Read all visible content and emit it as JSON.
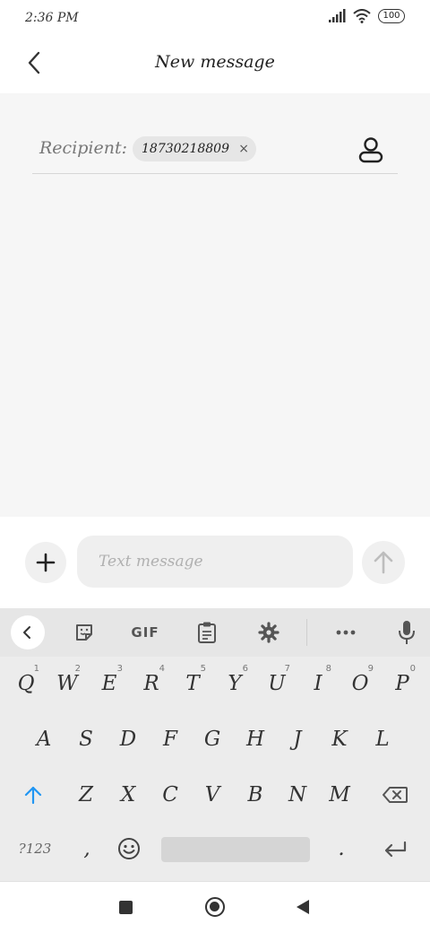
{
  "status_bar": {
    "time": "2:36 PM",
    "battery": "100"
  },
  "header": {
    "title": "New message",
    "back_icon": "chevron-left-icon"
  },
  "recipient": {
    "label": "Recipient:",
    "chip_value": "18730218809",
    "chip_remove": "×",
    "contact_icon": "person-icon"
  },
  "compose": {
    "placeholder": "Text message",
    "add_icon": "plus-icon",
    "send_icon": "arrow-up-icon"
  },
  "keyboard": {
    "toolbar": {
      "collapse_icon": "chevron-left-icon",
      "sticker_icon": "sticker-icon",
      "gif_label": "GIF",
      "clipboard_icon": "clipboard-icon",
      "settings_icon": "gear-icon",
      "more_icon": "more-horizontal-icon",
      "mic_icon": "microphone-icon"
    },
    "row1": [
      {
        "key": "Q",
        "hint": "1"
      },
      {
        "key": "W",
        "hint": "2"
      },
      {
        "key": "E",
        "hint": "3"
      },
      {
        "key": "R",
        "hint": "4"
      },
      {
        "key": "T",
        "hint": "5"
      },
      {
        "key": "Y",
        "hint": "6"
      },
      {
        "key": "U",
        "hint": "7"
      },
      {
        "key": "I",
        "hint": "8"
      },
      {
        "key": "O",
        "hint": "9"
      },
      {
        "key": "P",
        "hint": "0"
      }
    ],
    "row2": [
      "A",
      "S",
      "D",
      "F",
      "G",
      "H",
      "J",
      "K",
      "L"
    ],
    "row3": [
      "Z",
      "X",
      "C",
      "V",
      "B",
      "N",
      "M"
    ],
    "symbols_label": "?123",
    "comma": ",",
    "period": ".",
    "shift_icon": "shift-arrow-icon",
    "backspace_icon": "backspace-icon",
    "emoji_icon": "emoji-icon",
    "enter_icon": "enter-icon",
    "accent_color": "#2196f3"
  },
  "nav_bar": {
    "recents_icon": "square-icon",
    "home_icon": "circle-icon",
    "back_icon": "triangle-back-icon"
  }
}
